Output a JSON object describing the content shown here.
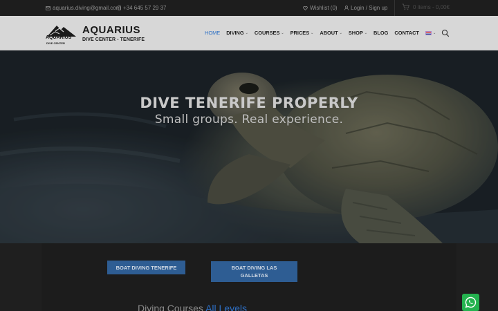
{
  "topbar": {
    "email": "aquarius.diving@gmail.com",
    "phone": "+34 645 57 29 37",
    "wishlist": "Wishlist (0)",
    "login": "Login / Sign up",
    "cart": "0 items - 0,00€"
  },
  "logo": {
    "name": "AQUARIUS",
    "subtitle": "DIVE CENTER - TENERIFE",
    "mark_text": "AQUARIUS",
    "mark_sub": "DIVE CENTER"
  },
  "nav": {
    "items": [
      {
        "label": "HOME",
        "active": true
      },
      {
        "label": "DIVING"
      },
      {
        "label": "COURSES"
      },
      {
        "label": "PRICES"
      },
      {
        "label": "ABOUT"
      },
      {
        "label": "SHOP"
      },
      {
        "label": "BLOG"
      },
      {
        "label": "CONTACT"
      }
    ]
  },
  "hero": {
    "title": "DIVE TENERIFE PROPERLY",
    "subtitle": "Small groups. Real experience."
  },
  "buttons": {
    "boat_tenerife": "BOAT DIVING TENERIFE",
    "boat_galletas": "BOAT DIVING LAS GALLETAS"
  },
  "courses": {
    "heading_main": "Diving Courses",
    "heading_accent": "All Levels"
  },
  "colors": {
    "accent": "#2a6ec4",
    "button_bg": "#2e5d93",
    "whatsapp": "#24b24f"
  }
}
